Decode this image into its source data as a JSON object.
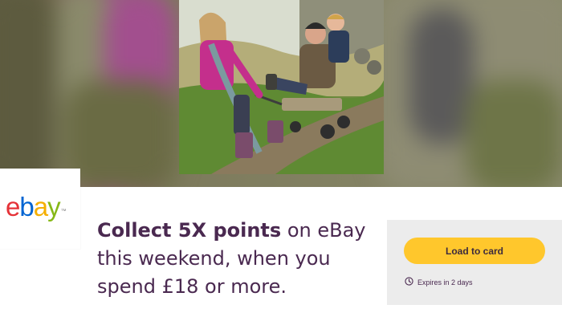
{
  "hero": {
    "photo_alt_icon": "family-photo",
    "colors": {
      "blurred_left": "#8a5a7e",
      "blurred_right": "#8f8c74"
    }
  },
  "brand": {
    "logo_letters": [
      "e",
      "b",
      "a",
      "y"
    ],
    "logo_colors": [
      "#e53238",
      "#0064d2",
      "#f5af02",
      "#86b817"
    ],
    "trademark": "™"
  },
  "offer": {
    "headline_bold": "Collect 5X points",
    "headline_rest": " on eBay this weekend, when you spend £18 or more.",
    "text_color": "#4a2950"
  },
  "actions": {
    "load_button_label": "Load to card",
    "button_color": "#ffc72c",
    "expiry_label": "Expires in 2 days",
    "expiry_icon": "clock-icon"
  }
}
